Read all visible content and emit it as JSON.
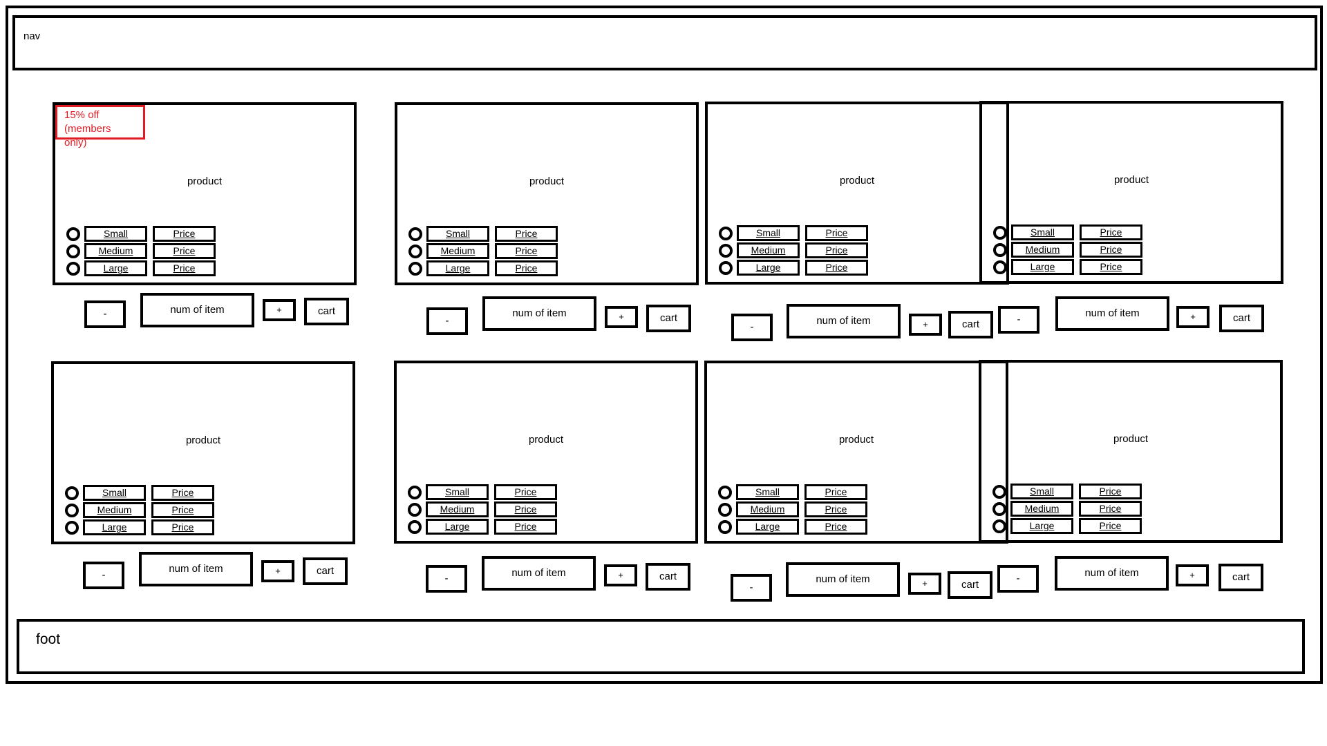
{
  "nav": {
    "label": "nav"
  },
  "foot": {
    "label": "foot"
  },
  "badge": {
    "line1": "15% off",
    "line2": "(members only)"
  },
  "products": [
    {
      "title": "product",
      "sizes": [
        "Small",
        "Medium",
        "Large"
      ],
      "prices": [
        "Price",
        "Price",
        "Price"
      ],
      "minus": "-",
      "count": "num of item",
      "plus": "+",
      "cart": "cart"
    },
    {
      "title": "product",
      "sizes": [
        "Small",
        "Medium",
        "Large"
      ],
      "prices": [
        "Price",
        "Price",
        "Price"
      ],
      "minus": "-",
      "count": "num of item",
      "plus": "+",
      "cart": "cart"
    },
    {
      "title": "product",
      "sizes": [
        "Small",
        "Medium",
        "Large"
      ],
      "prices": [
        "Price",
        "Price",
        "Price"
      ],
      "minus": "-",
      "count": "num of item",
      "plus": "+",
      "cart": "cart"
    },
    {
      "title": "product",
      "sizes": [
        "Small",
        "Medium",
        "Large"
      ],
      "prices": [
        "Price",
        "Price",
        "Price"
      ],
      "minus": "-",
      "count": "num of item",
      "plus": "+",
      "cart": "cart"
    },
    {
      "title": "product",
      "sizes": [
        "Small",
        "Medium",
        "Large"
      ],
      "prices": [
        "Price",
        "Price",
        "Price"
      ],
      "minus": "-",
      "count": "num of item",
      "plus": "+",
      "cart": "cart"
    },
    {
      "title": "product",
      "sizes": [
        "Small",
        "Medium",
        "Large"
      ],
      "prices": [
        "Price",
        "Price",
        "Price"
      ],
      "minus": "-",
      "count": "num of item",
      "plus": "+",
      "cart": "cart"
    },
    {
      "title": "product",
      "sizes": [
        "Small",
        "Medium",
        "Large"
      ],
      "prices": [
        "Price",
        "Price",
        "Price"
      ],
      "minus": "-",
      "count": "num of item",
      "plus": "+",
      "cart": "cart"
    },
    {
      "title": "product",
      "sizes": [
        "Small",
        "Medium",
        "Large"
      ],
      "prices": [
        "Price",
        "Price",
        "Price"
      ],
      "minus": "-",
      "count": "num of item",
      "plus": "+",
      "cart": "cart"
    }
  ],
  "colors": {
    "line": "#000000",
    "badge": "#e01b24"
  }
}
